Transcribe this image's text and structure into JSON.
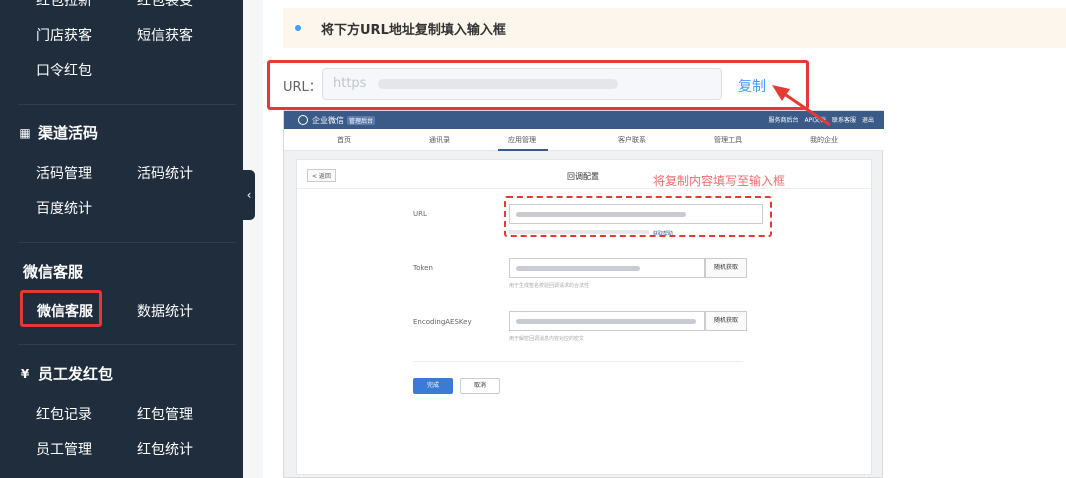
{
  "sidebar": {
    "top_items": [
      "红包拉新",
      "红包裂变"
    ],
    "row1": [
      "门店获客",
      "短信获客"
    ],
    "row2": [
      "口令红包"
    ],
    "section_channel": {
      "title": "渠道活码",
      "icon": "qr-grid-icon",
      "items": [
        "活码管理",
        "活码统计",
        "百度统计"
      ]
    },
    "section_wechat": {
      "title": "微信客服",
      "items": [
        "微信客服",
        "数据统计"
      ],
      "active": "微信客服"
    },
    "section_staff": {
      "title": "员工发红包",
      "icon": "yen-circle-icon",
      "items": [
        "红包记录",
        "红包管理",
        "员工管理",
        "红包统计"
      ]
    }
  },
  "notice": {
    "text": "将下方URL地址复制填入输入框"
  },
  "url_field": {
    "label": "URL：",
    "value": "https"
  },
  "copy_label": "复制",
  "colors": {
    "sidebar_bg": "#1f2d3d",
    "accent": "#409eff",
    "highlight": "#e53935"
  },
  "screenshot": {
    "logo_text": "企业微信",
    "logo_tag": "管理后台",
    "top_links": [
      "服务商后台",
      "API文档",
      "联系客服",
      "退出"
    ],
    "nav": [
      "首页",
      "通讯录",
      "应用管理",
      "客户联系",
      "管理工具",
      "我的企业"
    ],
    "nav_active": "应用管理",
    "back_label": "< 返回",
    "card_title": "回调配置",
    "annotation": "将复制内容填写至输入框",
    "fields": [
      {
        "label": "URL"
      },
      {
        "label": "Token",
        "button": "随机获取",
        "hint": "用于生成签名校验回调请求的合法性"
      },
      {
        "label": "EncodingAESKey",
        "button": "随机获取",
        "hint": "用于解密回调消息内容对应的密文"
      }
    ],
    "url_hint_link": "获取帮助",
    "done_label": "完成",
    "cancel_label": "取消"
  }
}
